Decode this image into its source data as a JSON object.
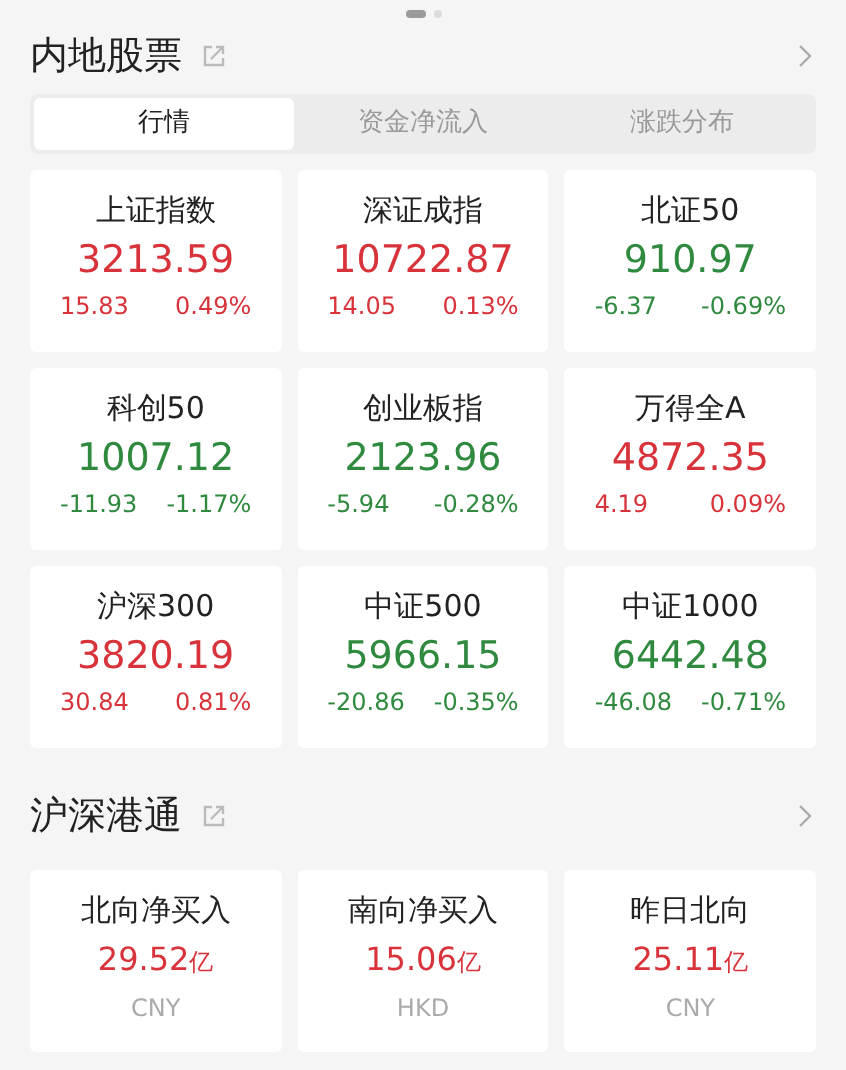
{
  "pager": [
    {
      "selected": true
    },
    {
      "selected": false
    }
  ],
  "sections": [
    {
      "title": "内地股票",
      "tabs": [
        {
          "label": "行情",
          "selected": true
        },
        {
          "label": "资金净流入",
          "selected": false
        },
        {
          "label": "涨跌分布",
          "selected": false
        }
      ],
      "cards": [
        {
          "kind": "index",
          "name": "上证指数",
          "value": "3213.59",
          "change": "15.83",
          "percent": "0.49%",
          "color": "#d8333b"
        },
        {
          "kind": "index",
          "name": "深证成指",
          "value": "10722.87",
          "change": "14.05",
          "percent": "0.13%",
          "color": "#d8333b"
        },
        {
          "kind": "index",
          "name": "北证50",
          "value": "910.97",
          "change": "-6.37",
          "percent": "-0.69%",
          "color": "#2f8a3f"
        },
        {
          "kind": "index",
          "name": "科创50",
          "value": "1007.12",
          "change": "-11.93",
          "percent": "-1.17%",
          "color": "#2f8a3f"
        },
        {
          "kind": "index",
          "name": "创业板指",
          "value": "2123.96",
          "change": "-5.94",
          "percent": "-0.28%",
          "color": "#2f8a3f"
        },
        {
          "kind": "index",
          "name": "万得全A",
          "value": "4872.35",
          "change": "4.19",
          "percent": "0.09%",
          "color": "#d8333b"
        },
        {
          "kind": "index",
          "name": "沪深300",
          "value": "3820.19",
          "change": "30.84",
          "percent": "0.81%",
          "color": "#d8333b"
        },
        {
          "kind": "index",
          "name": "中证500",
          "value": "5966.15",
          "change": "-20.86",
          "percent": "-0.35%",
          "color": "#2f8a3f"
        },
        {
          "kind": "index",
          "name": "中证1000",
          "value": "6442.48",
          "change": "-46.08",
          "percent": "-0.71%",
          "color": "#2f8a3f"
        }
      ]
    },
    {
      "title": "沪深港通",
      "cards": [
        {
          "kind": "flow",
          "name": "北向净买入",
          "value": "29.52",
          "unit": "亿",
          "currency": "CNY",
          "color": "#d8333b"
        },
        {
          "kind": "flow",
          "name": "南向净买入",
          "value": "15.06",
          "unit": "亿",
          "currency": "HKD",
          "color": "#d8333b"
        },
        {
          "kind": "flow",
          "name": "昨日北向",
          "value": "25.11",
          "unit": "亿",
          "currency": "CNY",
          "color": "#d8333b"
        }
      ]
    }
  ]
}
